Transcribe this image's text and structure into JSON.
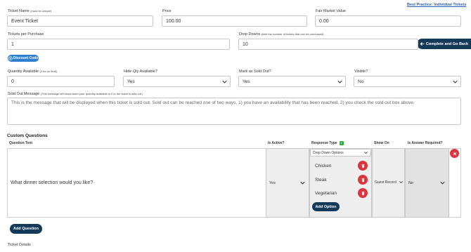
{
  "best_practice_link": "Best Practice: Individual Tickets",
  "complete_button": "Complete and Go Back",
  "ticket_name": {
    "label": "Ticket Name",
    "note": "(must be unique)",
    "value": "Event Ticket"
  },
  "price": {
    "label": "Price",
    "value": "100.00"
  },
  "fair_market_value": {
    "label": "Fair Market Value",
    "value": "0.00"
  },
  "tickets_per_purchase": {
    "label": "Tickets per Purchase",
    "value": "1"
  },
  "drop_downs": {
    "label": "Drop Downs",
    "note": "(limit the number of tickets that can be purchased)",
    "value": "10"
  },
  "discount_code_button": "Discount Code",
  "quantity_available": {
    "label": "Quantity Available",
    "note": "(0 for no limit)",
    "value": "0"
  },
  "hide_qty": {
    "label": "Hide Qty Available?",
    "value": "Yes"
  },
  "mark_sold_out": {
    "label": "Mark as Sold Out?",
    "value": "Yes"
  },
  "visible": {
    "label": "Visible?",
    "value": "No"
  },
  "sold_out_message": {
    "label": "Sold Out Message",
    "note": "(This message will show when your quantity available is 0 or the ticket is sold out.)",
    "value": "This is the message that will be displayed when this ticket is sold out. Sold out can be reached one of two ways, 1) you have an availability that has been reached, 2) you check the sold out box above."
  },
  "custom_questions": {
    "heading": "Custom Questions",
    "headers": {
      "question_text": "Question Text",
      "is_active": "Is Active?",
      "response_type": "Response Type",
      "show_on": "Show On",
      "is_answer_required": "Is Answer Required?"
    },
    "rows": [
      {
        "question": "What dinner selection would you like?",
        "is_active": "Yes",
        "response_type": "Drop Down Options",
        "options": [
          "Chicken",
          "Steak",
          "Vegetarian"
        ],
        "add_option": "Add Option",
        "show_on": "Guest Record",
        "is_answer_required": "No"
      }
    ],
    "add_question": "Add Question"
  },
  "ticket_details_label": "Ticket Details",
  "icons": {
    "back": "arrow-left-icon",
    "discount": "plus-circle-icon",
    "chevron": "chevron-down-icon",
    "trash": "trash-icon",
    "close": "close-icon",
    "response_info": "info-badge-icon"
  },
  "colors": {
    "navy": "#143a5a",
    "blue": "#2f7fd1",
    "red": "#d9363e",
    "green": "#3aa845",
    "link": "#2a5db0"
  }
}
